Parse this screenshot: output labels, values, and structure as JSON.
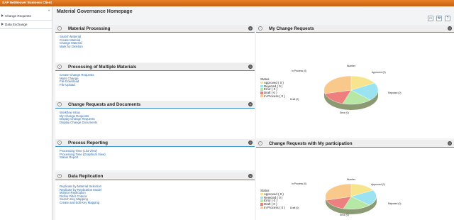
{
  "app": {
    "title": "SAP NetWeaver Business Client"
  },
  "sidebar": {
    "collapse_glyph": "«",
    "items": [
      {
        "label": "Change Requests",
        "icon": "triangle-right-icon"
      },
      {
        "label": "Data Exchange",
        "icon": "triangle-right-icon"
      }
    ]
  },
  "page": {
    "title": "Material Governance Homepage",
    "toolbar": [
      "printer-icon",
      "wrench-icon",
      "help-icon",
      "settings-icon"
    ]
  },
  "panels": {
    "material_processing": {
      "title": "Material Processing",
      "links": [
        "Search Material",
        "Create Material",
        "Change Material",
        "Mark for Deletion"
      ]
    },
    "multiple_materials": {
      "title": "Processing of Multiple Materials",
      "links": [
        "Create Change Requests",
        "Mass Change",
        "File Download",
        "File Upload"
      ]
    },
    "change_requests_docs": {
      "title": "Change Requests and Documents",
      "links": [
        "Workflow Inbox",
        "My Change Requests",
        "Display Change Requests",
        "Display Change Documents"
      ]
    },
    "process_reporting": {
      "title": "Process Reporting",
      "links": [
        "Processing Time (List View)",
        "Processing Time (Graphical View)",
        "Status Report"
      ]
    },
    "data_replication": {
      "title": "Data Replication",
      "links": [
        "Replicate by Material Selection",
        "Replicate by Replication Model",
        "Monitor Replication",
        "Define Filter Criteria",
        "Search Key Mapping",
        "Create and Edit Key Mapping"
      ]
    },
    "my_change_requests": {
      "title": "My Change Requests"
    },
    "participation": {
      "title": "Change Requests with My participation"
    }
  },
  "chart_legend_title": "Status",
  "chart_labels": {
    "number": "Number",
    "approved": "Approved (0)",
    "rejected": "Rejected (0)",
    "error": "Error (0)",
    "draft": "Draft (0)",
    "in_process": "In Process (0)"
  },
  "chart_data": [
    {
      "type": "pie",
      "title": "My Change Requests",
      "legend_title": "Status",
      "legend": [
        "Approved ( 0 )",
        "Rejected ( 0 )",
        "Error ( 0 )",
        "Draft ( 0 )",
        "In Process ( 0 )"
      ],
      "categories": [
        "Approved",
        "Rejected",
        "Error",
        "Draft",
        "In Process"
      ],
      "values": [
        0,
        0,
        0,
        0,
        0
      ],
      "colors": [
        "#f6e58d",
        "#9be3f1",
        "#b7e7a4",
        "#ee7f7f",
        "#f8c98a"
      ],
      "legend_placement": "left"
    },
    {
      "type": "pie",
      "title": "Change Requests with My participation",
      "legend_title": "Status",
      "legend": [
        "Approved ( 0 )",
        "Rejected ( 0 )",
        "Error ( 0 )",
        "Draft ( 0 )",
        "In Process ( 0 )"
      ],
      "categories": [
        "Approved",
        "Rejected",
        "Error",
        "Draft",
        "In Process"
      ],
      "values": [
        0,
        0,
        0,
        0,
        0
      ],
      "colors": [
        "#f6e58d",
        "#9be3f1",
        "#b7e7a4",
        "#ee7f7f",
        "#f8c98a"
      ],
      "legend_placement": "left"
    }
  ]
}
